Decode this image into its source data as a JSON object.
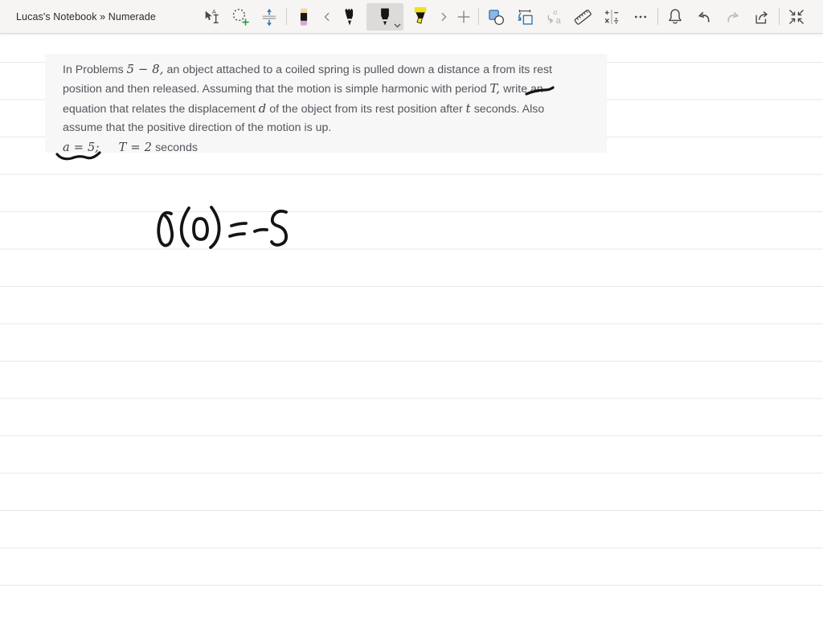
{
  "window": {
    "title": "Lucas's Notebook » Numerade"
  },
  "toolbar": {
    "selected_tool": "pen",
    "tools": [
      {
        "name": "select-type-tool"
      },
      {
        "name": "lasso-select-tool"
      },
      {
        "name": "insert-space-tool"
      },
      {
        "name": "eraser-tool"
      },
      {
        "name": "pen-scroll-left"
      },
      {
        "name": "pencil-tool"
      },
      {
        "name": "pen-tool"
      },
      {
        "name": "highlighter-tool"
      },
      {
        "name": "pen-scroll-right"
      },
      {
        "name": "add-pen"
      },
      {
        "name": "shapes-tool"
      },
      {
        "name": "ink-to-shape-tool"
      },
      {
        "name": "ink-to-text-tool"
      },
      {
        "name": "ruler-tool"
      },
      {
        "name": "math-tool"
      },
      {
        "name": "more-options"
      },
      {
        "name": "notifications"
      },
      {
        "name": "undo"
      },
      {
        "name": "redo"
      },
      {
        "name": "share"
      },
      {
        "name": "collapse-view"
      }
    ]
  },
  "problem": {
    "lines": [
      [
        {
          "t": "In Problems "
        },
        {
          "t": "5 − 8,",
          "m": 1
        },
        {
          "t": " an object attached to a coiled spring is pulled down a distance a from its rest"
        }
      ],
      [
        {
          "t": "position and then released. Assuming that the motion is simple harmonic with period "
        },
        {
          "t": "T,",
          "m": 1
        },
        {
          "t": " write an"
        }
      ],
      [
        {
          "t": "equation that relates the displacement "
        },
        {
          "t": "d",
          "m": 1
        },
        {
          "t": " of the object from its rest position after "
        },
        {
          "t": "t",
          "m": 1
        },
        {
          "t": " seconds. Also"
        }
      ],
      [
        {
          "t": "assume that the positive direction of the motion is up."
        }
      ],
      [
        {
          "t": "a = 5;",
          "m": 1
        },
        {
          "gap": 1
        },
        {
          "t": "T = 2",
          "m": 1
        },
        {
          "t": " seconds"
        }
      ]
    ]
  },
  "ink": {
    "handwriting_text": "d(0) = -5",
    "colors": {
      "stroke": "#141414"
    },
    "paths": [
      "M655,117 Q667,112 678,112 Q684,112 688,109",
      "M71,192 Q78,200 89,197 Q99,193 107,196 Q115,199 124,190",
      "M213,266 Q203,261 199,275 Q195,289 200,301 Q205,309 211,303 Q216,296 213,284 Q211,273 206,269",
      "M235,259 Q224,276 226,290 Q227,300 234,306",
      "M249,272 Q241,272 241,285 Q241,298 250,298 Q258,298 258,285 Q257,272 249,272",
      "M263,258 Q275,274 272,291 Q270,302 262,308",
      "M288,281 Q297,278 306,278",
      "M286,294 Q295,291 304,291",
      "M317,288 Q324,285 332,286",
      "M356,264 Q345,260 340,269 Q336,278 345,281 Q355,284 356,293 Q357,303 346,305 Q340,305 338,301"
    ]
  },
  "page": {
    "ruled_line_color": "#e5e8e8",
    "block_bg": "#f7f7f8",
    "accent_blue": "#2e77b8",
    "accent_green": "#1e9e3e",
    "highlighter_yellow": "#f3e11c",
    "eraser_tan": "#f2d9a4",
    "eraser_pink": "#d9a9d4"
  }
}
